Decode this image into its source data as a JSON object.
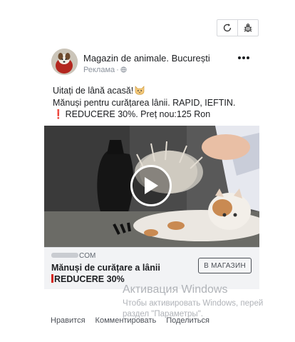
{
  "toolbar": {
    "refresh_icon": "refresh-icon",
    "bug_icon": "bug-icon"
  },
  "post": {
    "page_name": "Magazin de animale. București",
    "sponsored_label": "Реклама",
    "privacy_icon": "globe-icon",
    "more_icon": "more-horizontal-icon",
    "text_lines": [
      "Uitați de lână acasă!",
      "Mănuși pentru curățarea lânii. RAPID, IEFTIN.",
      "REDUCERE 30%. Preț nou:125 Ron"
    ],
    "text_emoji": "cat-face-emoji",
    "text_warning_icon": "❗",
    "media": {
      "play_icon": "play-icon"
    },
    "link": {
      "domain_suffix": "COM",
      "title": "Mănuși de curățare a lânii",
      "description": "REDUCERE 30%",
      "cta": "В МАГАЗИН"
    },
    "actions": [
      "Нравится",
      "Комментировать",
      "Поделиться"
    ]
  },
  "watermark": {
    "title": "Активация Windows",
    "line1": "Чтобы активировать Windows, перей",
    "line2": "раздел \"Параметры\"."
  },
  "colors": {
    "accent_red": "#e0201b",
    "text": "#1c1e21",
    "secondary_text": "#606770",
    "link_box_bg": "#f2f3f5"
  }
}
